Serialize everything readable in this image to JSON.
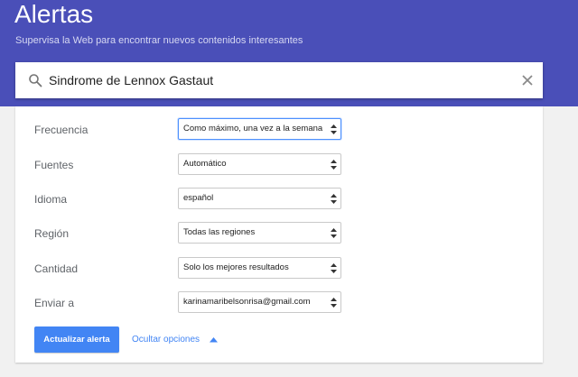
{
  "header": {
    "title": "Alertas",
    "subtitle": "Supervisa la Web para encontrar nuevos contenidos interesantes",
    "background": "#4a4fb8"
  },
  "search": {
    "value": "Sindrome de Lennox Gastaut",
    "search_icon": "search-icon",
    "clear_icon": "close-icon"
  },
  "options": [
    {
      "label": "Frecuencia",
      "value": "Como máximo, una vez a la semana",
      "focused": true
    },
    {
      "label": "Fuentes",
      "value": "Automático"
    },
    {
      "label": "Idioma",
      "value": "español"
    },
    {
      "label": "Región",
      "value": "Todas las regiones"
    },
    {
      "label": "Cantidad",
      "value": "Solo los mejores resultados"
    },
    {
      "label": "Enviar a",
      "value": "karinamaribelsonrisa@gmail.com"
    }
  ],
  "actions": {
    "update_label": "Actualizar alerta",
    "hide_options_label": "Ocultar opciones",
    "accent": "#4285f4"
  }
}
